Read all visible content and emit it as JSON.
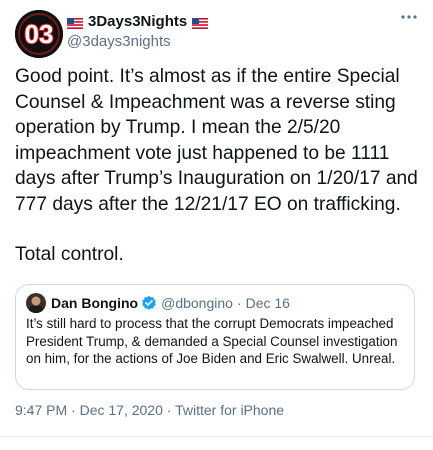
{
  "tweet": {
    "author": {
      "flag_left": "🇺🇸",
      "display_name": "3Days3Nights",
      "flag_right": "🇺🇸",
      "handle": "@3days3nights",
      "avatar_text": "03"
    },
    "more_icon": "more-horizontal-icon",
    "paragraphs": [
      "Good point. It’s almost as if the entire Special Counsel & Impeachment was a reverse sting operation by Trump. I mean the 2/5/20 impeachment vote just happened to be 1111 days after Trump’s Inauguration on 1/20/17 and 777 days after the 12/21/17 EO on trafficking.",
      "Total control."
    ],
    "quote": {
      "display_name": "Dan Bongino",
      "handle": "@dbongino",
      "separator": "·",
      "date": "Dec 16",
      "text": "It’s still hard to process that the corrupt Democrats impeached President Trump, & demanded a Special Counsel investigation on him, for the actions of Joe Biden and Eric Swalwell. Unreal."
    },
    "footer": {
      "time": "9:47 PM",
      "date": "Dec 17, 2020",
      "source": "Twitter for iPhone",
      "separator": "·"
    },
    "colors": {
      "text": "#0f1419",
      "secondary": "#5b7083",
      "verified": "#1da1f2",
      "avatar_red": "#e0242b"
    }
  }
}
